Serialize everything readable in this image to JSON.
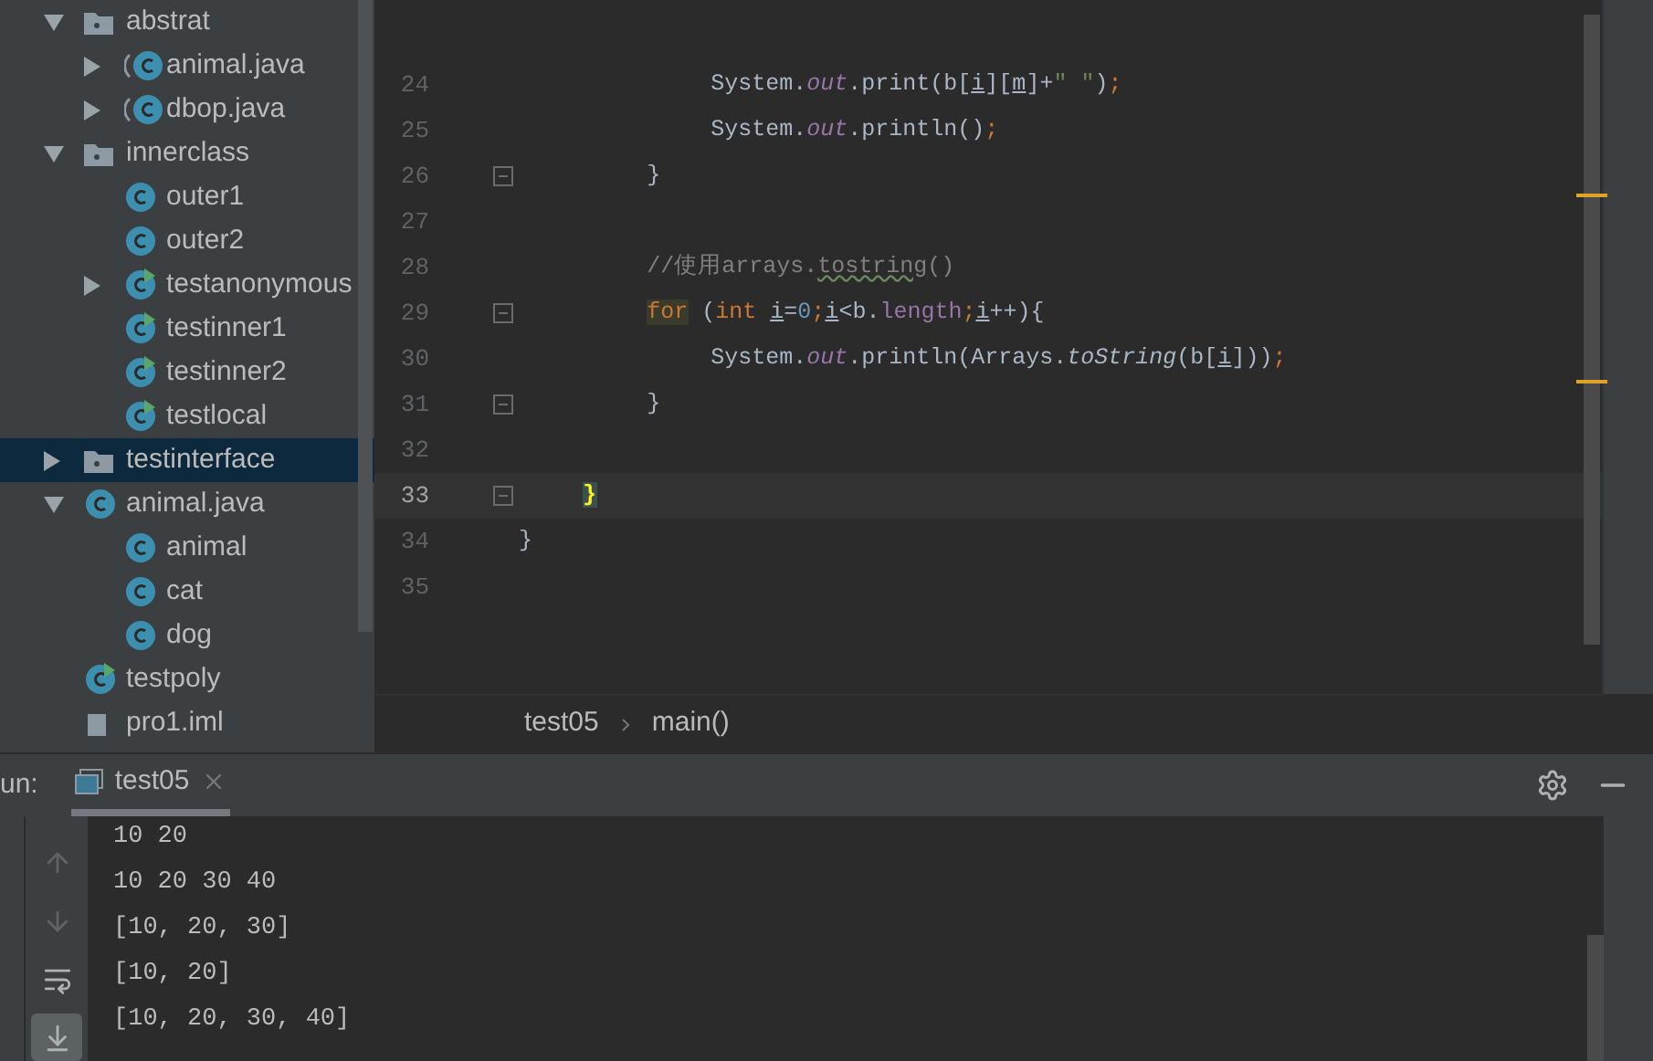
{
  "project_tree": {
    "items": [
      {
        "label": "abstrat",
        "kind": "package",
        "expanded": true,
        "selected": false,
        "children": [
          {
            "label": "animal.java",
            "kind": "abstract-class",
            "expanded": false,
            "selected": false
          },
          {
            "label": "dbop.java",
            "kind": "abstract-class",
            "expanded": false,
            "selected": false
          }
        ]
      },
      {
        "label": "innerclass",
        "kind": "package",
        "expanded": true,
        "selected": false,
        "children": [
          {
            "label": "outer1",
            "kind": "class",
            "selected": false
          },
          {
            "label": "outer2",
            "kind": "class",
            "selected": false
          },
          {
            "label": "testanonymous",
            "kind": "runnable-class",
            "expanded": false,
            "selected": false
          },
          {
            "label": "testinner1",
            "kind": "runnable-class",
            "selected": false
          },
          {
            "label": "testinner2",
            "kind": "runnable-class",
            "selected": false
          },
          {
            "label": "testlocal",
            "kind": "runnable-class",
            "selected": false
          }
        ]
      },
      {
        "label": "testinterface",
        "kind": "package",
        "expanded": false,
        "selected": true
      },
      {
        "label": "animal.java",
        "kind": "class",
        "expanded": true,
        "selected": false,
        "children": [
          {
            "label": "animal",
            "kind": "class",
            "selected": false
          },
          {
            "label": "cat",
            "kind": "class",
            "selected": false
          },
          {
            "label": "dog",
            "kind": "class",
            "selected": false
          }
        ]
      },
      {
        "label": "testpoly",
        "kind": "runnable-class",
        "selected": false
      },
      {
        "label": "pro1.iml",
        "kind": "file",
        "selected": false
      }
    ]
  },
  "editor": {
    "lines": [
      {
        "number": "24",
        "current": false,
        "fold": false,
        "tokens": [
          {
            "text": "            System.",
            "kind": "plain"
          },
          {
            "text": "out",
            "kind": "field"
          },
          {
            "text": ".print(b[",
            "kind": "plain"
          },
          {
            "text": "i",
            "kind": "var"
          },
          {
            "text": "][",
            "kind": "plain"
          },
          {
            "text": "m",
            "kind": "var"
          },
          {
            "text": "]+",
            "kind": "plain"
          },
          {
            "text": "\" \"",
            "kind": "str"
          },
          {
            "text": ")",
            "kind": "plain"
          },
          {
            "text": ";",
            "kind": "kw"
          }
        ]
      },
      {
        "number": "25",
        "current": false,
        "fold": false,
        "tokens": [
          {
            "text": "            System.",
            "kind": "plain"
          },
          {
            "text": "out",
            "kind": "field"
          },
          {
            "text": ".println()",
            "kind": "plain"
          },
          {
            "text": ";",
            "kind": "kw"
          }
        ]
      },
      {
        "number": "26",
        "current": false,
        "fold": true,
        "tokens": [
          {
            "text": "        }",
            "kind": "plain"
          }
        ]
      },
      {
        "number": "27",
        "current": false,
        "fold": false
      },
      {
        "number": "28",
        "current": false,
        "fold": false,
        "tokens": [
          {
            "text": "        //使用arrays.",
            "kind": "comment"
          },
          {
            "text": "tostring",
            "kind": "typo"
          },
          {
            "text": "()",
            "kind": "comment"
          }
        ]
      },
      {
        "number": "29",
        "current": false,
        "fold": true,
        "tokens": [
          {
            "text": "        for",
            "kind": "kw-match"
          },
          {
            "text": " (",
            "kind": "plain"
          },
          {
            "text": "int ",
            "kind": "kw"
          },
          {
            "text": "i",
            "kind": "var"
          },
          {
            "text": "=",
            "kind": "plain"
          },
          {
            "text": "0",
            "kind": "num"
          },
          {
            "text": ";",
            "kind": "kw"
          },
          {
            "text": "i",
            "kind": "var"
          },
          {
            "text": "<b.",
            "kind": "plain"
          },
          {
            "text": "length",
            "kind": "field-plain"
          },
          {
            "text": ";",
            "kind": "kw"
          },
          {
            "text": "i",
            "kind": "var"
          },
          {
            "text": "++){",
            "kind": "plain"
          }
        ]
      },
      {
        "number": "30",
        "current": false,
        "fold": false,
        "tokens": [
          {
            "text": "            System.",
            "kind": "plain"
          },
          {
            "text": "out",
            "kind": "field"
          },
          {
            "text": ".println(Arrays.",
            "kind": "plain"
          },
          {
            "text": "toString",
            "kind": "static"
          },
          {
            "text": "(b[",
            "kind": "plain"
          },
          {
            "text": "i",
            "kind": "var"
          },
          {
            "text": "]))",
            "kind": "plain"
          },
          {
            "text": ";",
            "kind": "kw"
          }
        ]
      },
      {
        "number": "31",
        "current": false,
        "fold": true,
        "tokens": [
          {
            "text": "        }",
            "kind": "plain"
          }
        ]
      },
      {
        "number": "32",
        "current": false,
        "fold": false
      },
      {
        "number": "33",
        "current": true,
        "fold": true,
        "tokens": [
          {
            "text": "    }",
            "kind": "brace-match"
          }
        ]
      },
      {
        "number": "34",
        "current": false,
        "fold": false,
        "tokens": [
          {
            "text": "}",
            "kind": "plain"
          }
        ]
      },
      {
        "number": "35",
        "current": false,
        "fold": false
      }
    ],
    "breadcrumbs": [
      "test05",
      "main()"
    ]
  },
  "run_panel": {
    "label": "un:",
    "tab": {
      "title": "test05",
      "selected": true
    },
    "toolbar": [
      {
        "kind": "up",
        "selected": false
      },
      {
        "kind": "down",
        "selected": false
      },
      {
        "kind": "wrap",
        "selected": false
      },
      {
        "kind": "scroll-end",
        "selected": true
      }
    ],
    "output": [
      "10 20",
      "10 20 30 40",
      "[10, 20, 30]",
      "[10, 20]",
      "[10, 20, 30, 40]"
    ]
  }
}
